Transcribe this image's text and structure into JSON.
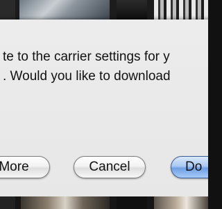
{
  "dialog": {
    "message_line1": "te to the carrier settings for y",
    "message_line2": ". Would you like to download"
  },
  "buttons": {
    "more_label": "More",
    "cancel_label": "Cancel",
    "default_label": "Do"
  },
  "colors": {
    "dialog_background": "#ececec",
    "default_button": "#8fb6ec",
    "backdrop": "#1a1a1a"
  }
}
